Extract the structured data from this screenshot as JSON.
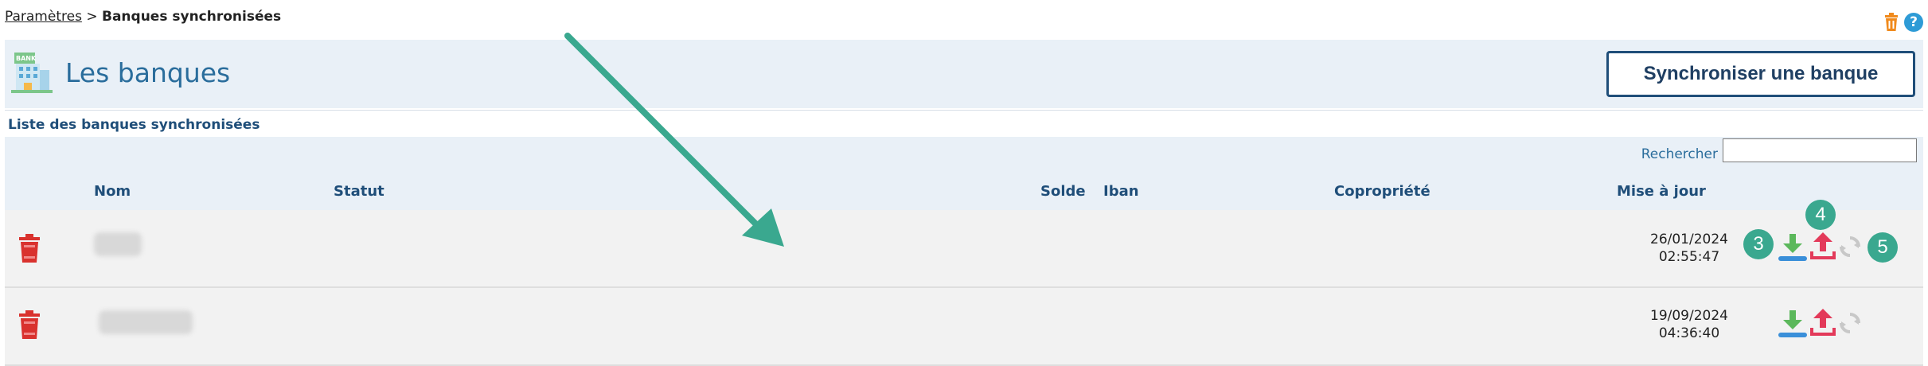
{
  "breadcrumb": {
    "parent": "Paramètres",
    "separator": ">",
    "current": "Banques synchronisées"
  },
  "header": {
    "title": "Les banques",
    "sync_button": "Synchroniser une banque",
    "icon_label": "BANK"
  },
  "subheader": {
    "title": "Liste des banques synchronisées"
  },
  "search": {
    "label": "Rechercher",
    "value": ""
  },
  "table": {
    "columns": [
      "Nom",
      "Statut",
      "Solde",
      "Iban",
      "Copropriété",
      "Mise à jour"
    ],
    "rows": [
      {
        "date": "26/01/2024",
        "time": "02:55:47"
      },
      {
        "date": "19/09/2024",
        "time": "04:36:40"
      }
    ]
  },
  "annotations": {
    "badges": [
      "3",
      "4",
      "5"
    ]
  },
  "colors": {
    "accent": "#2a6d9c",
    "button_border": "#1f4e79",
    "badge": "#3aa88f",
    "arrow": "#3aa88f",
    "download": "#5cb85c",
    "upload": "#e33a5a"
  }
}
